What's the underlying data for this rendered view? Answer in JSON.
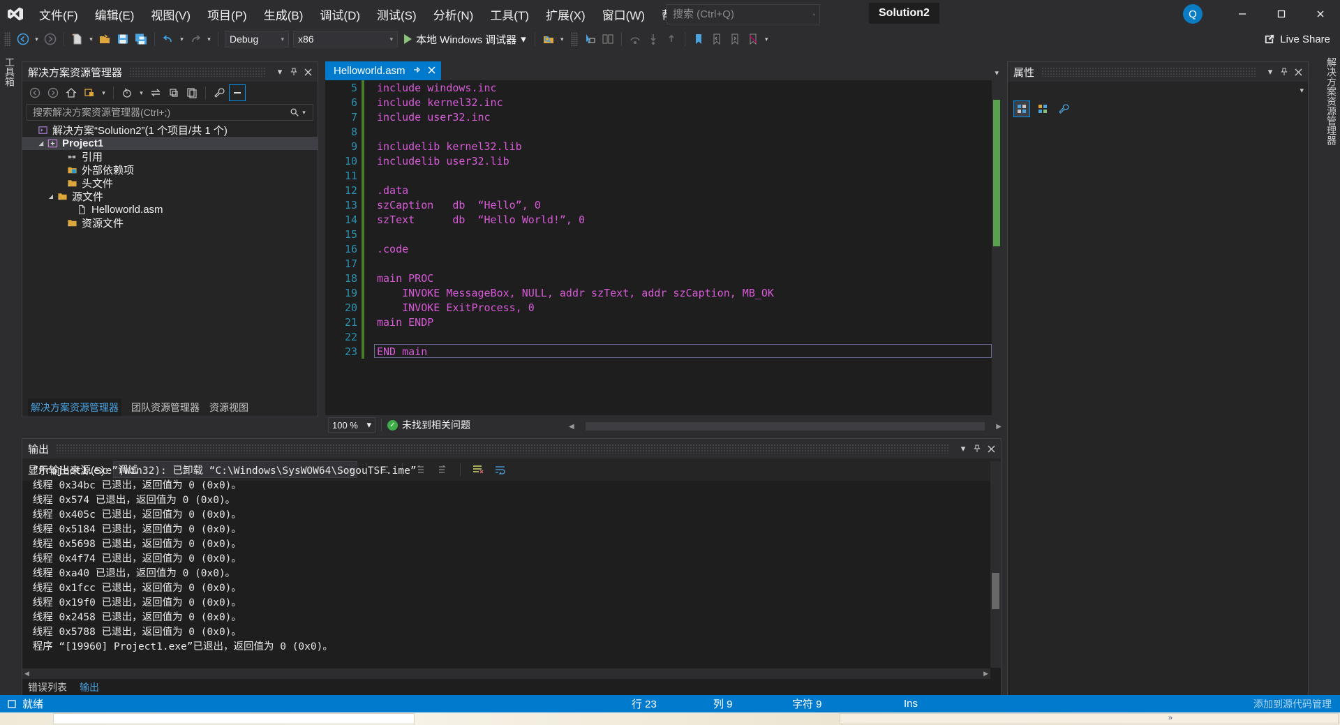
{
  "app": {
    "title": "Solution2",
    "logo_icon": "visual-studio-logo"
  },
  "menu": {
    "items": [
      {
        "label": "文件(F)"
      },
      {
        "label": "编辑(E)"
      },
      {
        "label": "视图(V)"
      },
      {
        "label": "项目(P)"
      },
      {
        "label": "生成(B)"
      },
      {
        "label": "调试(D)"
      },
      {
        "label": "测试(S)"
      },
      {
        "label": "分析(N)"
      },
      {
        "label": "工具(T)"
      },
      {
        "label": "扩展(X)"
      },
      {
        "label": "窗口(W)"
      },
      {
        "label": "帮助(H)"
      }
    ]
  },
  "search": {
    "placeholder": "搜索 (Ctrl+Q)",
    "value": "",
    "icon": "search-icon"
  },
  "window_controls": {
    "minimize": "–",
    "maximize": "☐",
    "close": "✕",
    "feedback": "Q"
  },
  "toolbar": {
    "config": {
      "label": "Debug",
      "arrow": "▾"
    },
    "platform": {
      "label": "x86",
      "arrow": "▾"
    },
    "run": {
      "label": "本地 Windows 调试器",
      "arrow": "▾"
    },
    "live_share": {
      "label": "Live Share"
    }
  },
  "vertical_tabs": {
    "left": "工具箱",
    "right": "解决方案资源管理器"
  },
  "solution_explorer": {
    "title": "解决方案资源管理器",
    "search_placeholder": "搜索解决方案资源管理器(Ctrl+;)",
    "tree": [
      {
        "label": "解决方案“Solution2”(1 个项目/共 1 个)",
        "indent": 0,
        "arrow": "",
        "icon": "solution-icon",
        "bold": false,
        "selected": false
      },
      {
        "label": "Project1",
        "indent": 1,
        "arrow": "◢",
        "icon": "project-icon",
        "bold": true,
        "selected": true
      },
      {
        "label": "引用",
        "indent": 3,
        "arrow": "",
        "icon": "references-icon",
        "bold": false,
        "selected": false
      },
      {
        "label": "外部依赖项",
        "indent": 3,
        "arrow": "",
        "icon": "ext-deps-folder-icon",
        "bold": false,
        "selected": false
      },
      {
        "label": "头文件",
        "indent": 3,
        "arrow": "",
        "icon": "folder-icon",
        "bold": false,
        "selected": false
      },
      {
        "label": "源文件",
        "indent": 2,
        "arrow": "◢",
        "icon": "folder-icon",
        "bold": false,
        "selected": false
      },
      {
        "label": "Helloworld.asm",
        "indent": 4,
        "arrow": "",
        "icon": "file-icon",
        "bold": false,
        "selected": false
      },
      {
        "label": "资源文件",
        "indent": 3,
        "arrow": "",
        "icon": "folder-icon",
        "bold": false,
        "selected": false
      }
    ],
    "tabs": [
      {
        "label": "解决方案资源管理器",
        "active": true
      },
      {
        "label": "团队资源管理器",
        "active": false
      },
      {
        "label": "资源视图",
        "active": false
      }
    ]
  },
  "editor": {
    "tab": {
      "label": "Helloworld.asm",
      "pin_icon": "pin-icon",
      "close_icon": "close-icon"
    },
    "lines": [
      {
        "no": "5",
        "text": "include windows.inc"
      },
      {
        "no": "6",
        "text": "include kernel32.inc"
      },
      {
        "no": "7",
        "text": "include user32.inc"
      },
      {
        "no": "8",
        "text": ""
      },
      {
        "no": "9",
        "text": "includelib kernel32.lib"
      },
      {
        "no": "10",
        "text": "includelib user32.lib"
      },
      {
        "no": "11",
        "text": ""
      },
      {
        "no": "12",
        "text": ".data"
      },
      {
        "no": "13",
        "text": "szCaption   db  “Hello”, 0"
      },
      {
        "no": "14",
        "text": "szText      db  “Hello World!”, 0"
      },
      {
        "no": "15",
        "text": ""
      },
      {
        "no": "16",
        "text": ".code"
      },
      {
        "no": "17",
        "text": ""
      },
      {
        "no": "18",
        "text": "main PROC"
      },
      {
        "no": "19",
        "text": "    INVOKE MessageBox, NULL, addr szText, addr szCaption, MB_OK"
      },
      {
        "no": "20",
        "text": "    INVOKE ExitProcess, 0"
      },
      {
        "no": "21",
        "text": "main ENDP"
      },
      {
        "no": "22",
        "text": ""
      },
      {
        "no": "23",
        "text": "END main"
      }
    ],
    "status": {
      "zoom": "100 %",
      "issues": "未找到相关问题",
      "ok_icon": "checkmark-icon"
    }
  },
  "properties": {
    "title": "属性"
  },
  "output": {
    "title": "输出",
    "source_label": "显示输出来源(S):",
    "source_value": "调试",
    "lines": [
      "“Project1.exe”(Win32): 已卸载 “C:\\Windows\\SysWOW64\\SogouTSF.ime”",
      "线程 0x34bc 已退出，返回值为 0 (0x0)。",
      "线程 0x574 已退出，返回值为 0 (0x0)。",
      "线程 0x405c 已退出，返回值为 0 (0x0)。",
      "线程 0x5184 已退出，返回值为 0 (0x0)。",
      "线程 0x5698 已退出，返回值为 0 (0x0)。",
      "线程 0x4f74 已退出，返回值为 0 (0x0)。",
      "线程 0xa40 已退出，返回值为 0 (0x0)。",
      "线程 0x1fcc 已退出，返回值为 0 (0x0)。",
      "线程 0x19f0 已退出，返回值为 0 (0x0)。",
      "线程 0x2458 已退出，返回值为 0 (0x0)。",
      "线程 0x5788 已退出，返回值为 0 (0x0)。",
      "程序 “[19960] Project1.exe”已退出，返回值为 0 (0x0)。"
    ],
    "tabs": [
      {
        "label": "错误列表",
        "active": false
      },
      {
        "label": "输出",
        "active": true
      }
    ]
  },
  "statusbar": {
    "ready": "就绪",
    "line": "行 23",
    "column": "列 9",
    "char": "字符 9",
    "insert": "Ins",
    "watermark": "添加到源代码管理"
  },
  "colors": {
    "accent": "#007acc",
    "code_text": "#d85ad8",
    "line_number": "#2b91af",
    "change_bar": "#4a7c2f",
    "editor_bg": "#1e1e1e",
    "chrome_bg": "#2d2d30",
    "panel_bg": "#252526"
  }
}
